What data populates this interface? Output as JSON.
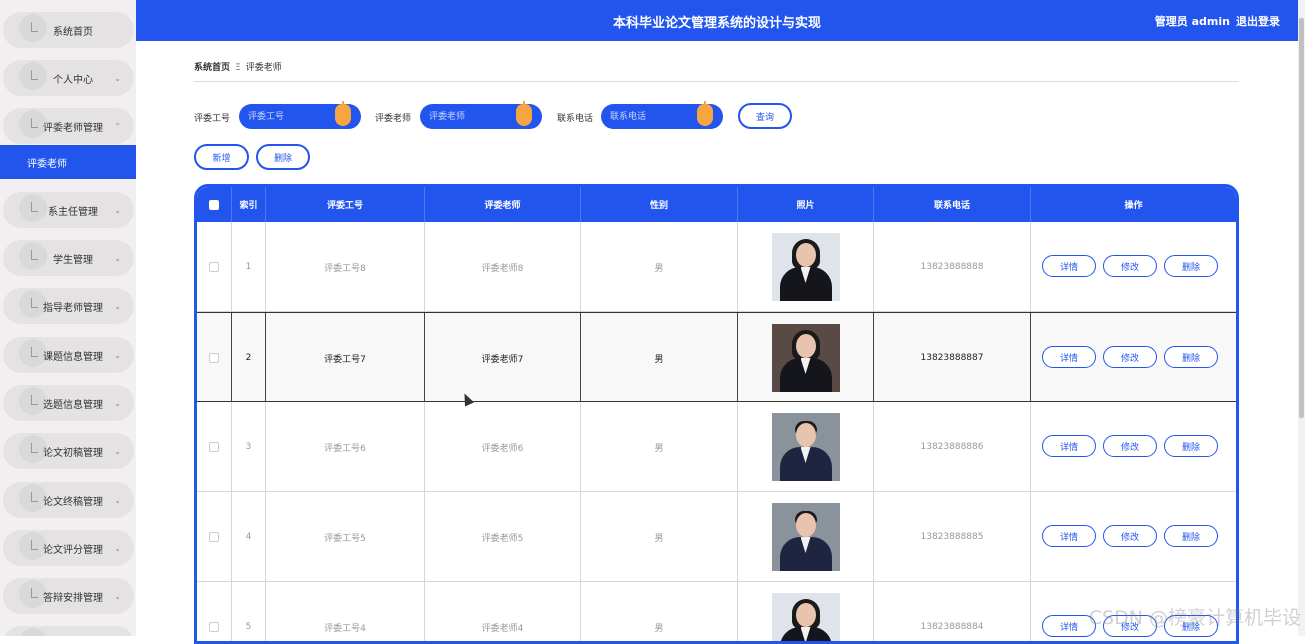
{
  "sidebar": {
    "items": [
      {
        "label": "系统首页",
        "chev": ""
      },
      {
        "label": "个人中心",
        "chev": "⌄"
      },
      {
        "label": "评委老师管理",
        "chev": "⌃"
      },
      {
        "label": "系主任管理",
        "chev": "⌄"
      },
      {
        "label": "学生管理",
        "chev": "⌄"
      },
      {
        "label": "指导老师管理",
        "chev": "⌄"
      },
      {
        "label": "课题信息管理",
        "chev": "⌄"
      },
      {
        "label": "选题信息管理",
        "chev": "⌄"
      },
      {
        "label": "论文初稿管理",
        "chev": "⌄"
      },
      {
        "label": "论文终稿管理",
        "chev": "⌄"
      },
      {
        "label": "论文评分管理",
        "chev": "⌄"
      },
      {
        "label": "答辩安排管理",
        "chev": "⌄"
      }
    ],
    "active_sub": "评委老师"
  },
  "header": {
    "title": "本科毕业论文管理系统的设计与实现",
    "user": "管理员 admin",
    "logout": "退出登录"
  },
  "breadcrumb": {
    "home": "系统首页",
    "sep": "Ξ",
    "current": "评委老师"
  },
  "search": {
    "f1_label": "评委工号",
    "f1_placeholder": "评委工号",
    "f2_label": "评委老师",
    "f2_placeholder": "评委老师",
    "f3_label": "联系电话",
    "f3_placeholder": "联系电话",
    "query": "查询",
    "add": "新增",
    "delete": "删除"
  },
  "table": {
    "headers": [
      "索引",
      "评委工号",
      "评委老师",
      "性别",
      "照片",
      "联系电话",
      "操作"
    ],
    "rows": [
      {
        "index": "1",
        "id": "评委工号8",
        "name": "评委老师8",
        "gender": "男",
        "phone": "13823888888",
        "photo": "female-portrait"
      },
      {
        "index": "2",
        "id": "评委工号7",
        "name": "评委老师7",
        "gender": "男",
        "phone": "13823888887",
        "photo": "female-portrait"
      },
      {
        "index": "3",
        "id": "评委工号6",
        "name": "评委老师6",
        "gender": "男",
        "phone": "13823888886",
        "photo": "male-portrait"
      },
      {
        "index": "4",
        "id": "评委工号5",
        "name": "评委老师5",
        "gender": "男",
        "phone": "13823888885",
        "photo": "male-portrait"
      },
      {
        "index": "5",
        "id": "评委工号4",
        "name": "评委老师4",
        "gender": "男",
        "phone": "13823888884",
        "photo": "female-portrait"
      }
    ],
    "actions": {
      "detail": "详情",
      "edit": "修改",
      "delete": "删除"
    }
  },
  "watermark": "CSDN @榜豪计算机毕设",
  "colors": {
    "primary": "#2255ee",
    "accent": "#f6a540",
    "sidebar_bg": "#f1efef"
  }
}
